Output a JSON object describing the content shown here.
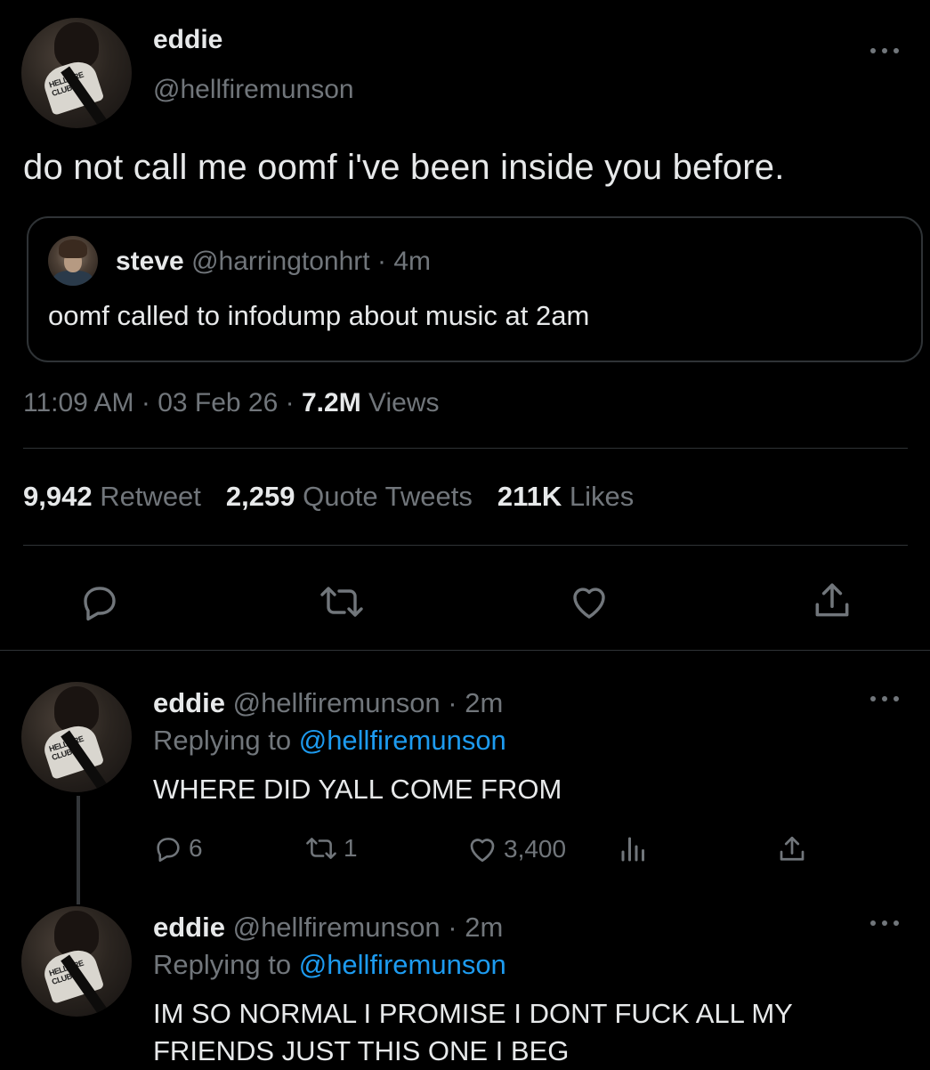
{
  "main_tweet": {
    "name": "eddie",
    "handle": "@hellfiremunson",
    "avatar_shirt_text": "HELLFIRE CLUB",
    "text": "do not call me oomf i've been inside you before.",
    "quote": {
      "name": "steve",
      "handle": "@harringtonhrt",
      "sep": " · ",
      "time": "4m",
      "text": "oomf called to infodump about music at 2am"
    },
    "meta": {
      "time": "11:09 AM",
      "sep1": " · ",
      "date": "03 Feb 26",
      "sep2": " · ",
      "views_count": "7.2M",
      "views_label": " Views"
    },
    "stats": {
      "retweets_count": "9,942",
      "retweets_label": " Retweet",
      "quotes_count": "2,259",
      "quotes_label": " Quote Tweets",
      "likes_count": "211K",
      "likes_label": " Likes"
    }
  },
  "replies": [
    {
      "name": "eddie",
      "handle": "@hellfiremunson",
      "sep": " · ",
      "time": "2m",
      "replying_prefix": "Replying to ",
      "replying_handle": "@hellfiremunson",
      "text": "WHERE DID YALL COME FROM",
      "reply_count": "6",
      "retweet_count": "1",
      "like_count": "3,400"
    },
    {
      "name": "eddie",
      "handle": "@hellfiremunson",
      "sep": " · ",
      "time": "2m",
      "replying_prefix": "Replying to ",
      "replying_handle": "@hellfiremunson",
      "text": "IM SO NORMAL I PROMISE I DONT FUCK ALL MY FRIENDS JUST THIS ONE I BEG"
    }
  ],
  "icons": {
    "reply": "reply-icon",
    "retweet": "retweet-icon",
    "like": "heart-icon",
    "share": "share-icon",
    "analytics": "analytics-icon",
    "more": "more-icon"
  },
  "colors": {
    "background": "#000000",
    "text": "#e7e9ea",
    "muted": "#71767b",
    "link": "#1d9bf0",
    "border": "#2f3336"
  }
}
